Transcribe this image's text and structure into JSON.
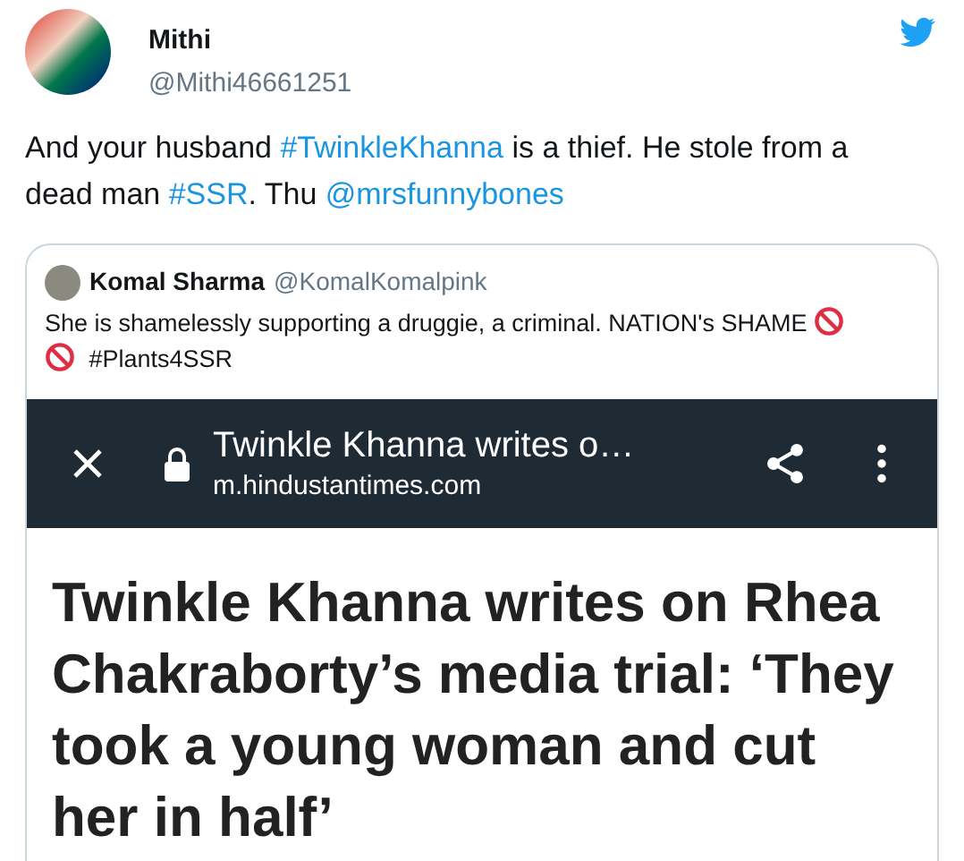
{
  "author": {
    "name": "Mithi",
    "handle": "@Mithi46661251"
  },
  "tweet_text": [
    {
      "kind": "text",
      "text": "And your husband "
    },
    {
      "kind": "link",
      "text": "#TwinkleKhanna"
    },
    {
      "kind": "text",
      "text": " is a thief. He stole from a dead man "
    },
    {
      "kind": "link",
      "text": "#SSR"
    },
    {
      "kind": "text",
      "text": ". Thu "
    },
    {
      "kind": "link",
      "text": "@mrsfunnybones"
    }
  ],
  "quoted_tweet": {
    "name": "Komal Sharma",
    "handle": "@KomalKomalpink",
    "text": [
      {
        "kind": "text",
        "text": "She is shamelessly supporting a druggie, a criminal. NATION's SHAME "
      },
      {
        "kind": "icon"
      },
      {
        "kind": "icon"
      },
      {
        "kind": "text",
        "text": " #Plants4SSR"
      }
    ],
    "browser_bar": {
      "title": "Twinkle Khanna writes o…",
      "url": "m.hindustantimes.com"
    },
    "headline": "Twinkle Khanna writes on Rhea Chakraborty’s media trial: ‘They took a young woman and cut her in half’"
  }
}
